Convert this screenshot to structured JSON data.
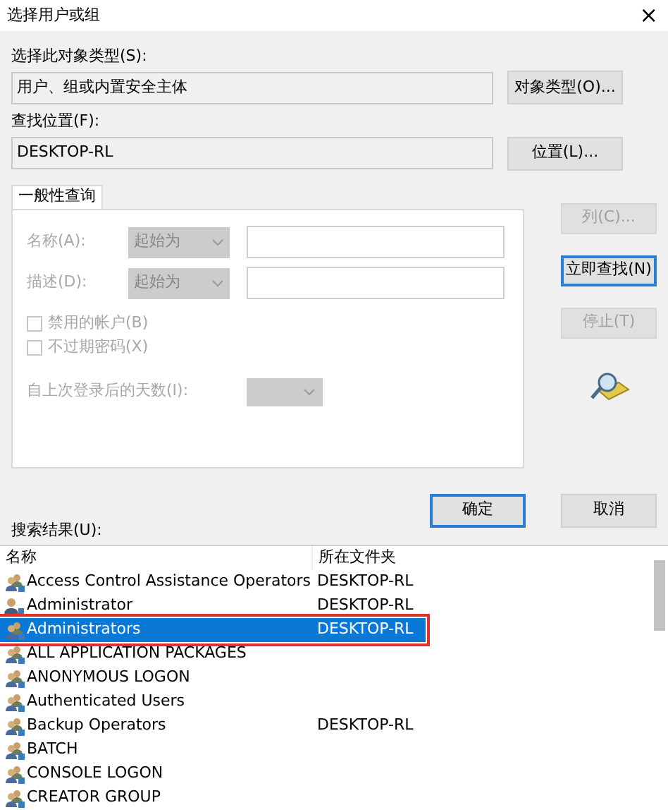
{
  "window": {
    "title": "选择用户或组",
    "close": "×"
  },
  "object_type": {
    "label": "选择此对象类型(S):",
    "value": "用户、组或内置安全主体",
    "button": "对象类型(O)..."
  },
  "location": {
    "label": "查找位置(F):",
    "value": "DESKTOP-RL",
    "button": "位置(L)..."
  },
  "tabs": [
    {
      "label": "一般性查询",
      "selected": true
    }
  ],
  "query": {
    "rows": [
      {
        "label": "名称(A):",
        "mode": "起始为",
        "disabled": true
      },
      {
        "label": "描述(D):",
        "mode": "起始为",
        "disabled": true
      }
    ],
    "checkboxes": [
      {
        "label": "禁用的帐户(B)",
        "checked": false,
        "disabled": true
      },
      {
        "label": "不过期密码(X)",
        "checked": false,
        "disabled": true
      }
    ],
    "days_label": "自上次登录后的天数(I):"
  },
  "side_buttons": [
    {
      "label": "列(C)...",
      "disabled": true,
      "default": false
    },
    {
      "label": "立即查找(N)",
      "disabled": false,
      "default": true
    },
    {
      "label": "停止(T)",
      "disabled": true,
      "default": false
    }
  ],
  "actions": [
    {
      "label": "确定",
      "default": true
    },
    {
      "label": "取消",
      "default": false
    }
  ],
  "results": {
    "label": "搜索结果(U):",
    "columns": [
      "名称",
      "所在文件夹"
    ],
    "rows": [
      {
        "kind": "group",
        "name": "Access Control Assistance Operators",
        "folder": "DESKTOP-RL",
        "selected": false
      },
      {
        "kind": "user",
        "name": "Administrator",
        "folder": "DESKTOP-RL",
        "selected": false
      },
      {
        "kind": "group",
        "name": "Administrators",
        "folder": "DESKTOP-RL",
        "selected": true
      },
      {
        "kind": "group",
        "name": "ALL APPLICATION PACKAGES",
        "selected": false
      },
      {
        "kind": "group",
        "name": "ANONYMOUS LOGON",
        "selected": false
      },
      {
        "kind": "group",
        "name": "Authenticated Users",
        "selected": false
      },
      {
        "kind": "group",
        "name": "Backup Operators",
        "folder": "DESKTOP-RL",
        "selected": false
      },
      {
        "kind": "group",
        "name": "BATCH",
        "selected": false
      },
      {
        "kind": "group",
        "name": "CONSOLE LOGON",
        "selected": false
      },
      {
        "kind": "group",
        "name": "CREATOR GROUP",
        "selected": false
      }
    ]
  }
}
